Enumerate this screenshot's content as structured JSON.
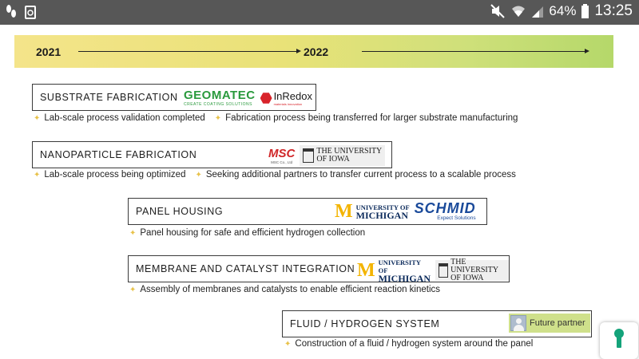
{
  "status_bar": {
    "battery_percent": "64%",
    "time": "13:25",
    "icons": [
      "steps-icon",
      "recycle-icon",
      "mute-icon",
      "wifi-icon",
      "signal-icon",
      "battery-icon"
    ]
  },
  "timeline": {
    "year_start": "2021",
    "year_mid": "2022"
  },
  "rows": {
    "substrate": {
      "title": "SUBSTRATE FABRICATION",
      "logo1_main": "GEOMATEC",
      "logo1_sub": "CREATE COATING SOLUTIONS",
      "logo2_main": "InRedox",
      "logo2_sub": "materials innovation",
      "bullet1": "Lab-scale process validation completed",
      "bullet2": "Fabrication process being transferred for larger substrate manufacturing"
    },
    "nanoparticle": {
      "title": "NANOPARTICLE FABRICATION",
      "logo1_main": "MSC",
      "logo1_sub": "MSC Co., Ltd",
      "logo2_l1": "THE UNIVERSITY",
      "logo2_l2": "OF IOWA",
      "bullet1": "Lab-scale process being optimized",
      "bullet2": "Seeking additional partners to transfer current process to a scalable process"
    },
    "panel": {
      "title": "PANEL HOUSING",
      "logo1_m": "M",
      "logo1_l1": "UNIVERSITY OF",
      "logo1_l2": "MICHIGAN",
      "logo2_main": "SCHMID",
      "logo2_sub": "Expect Solutions",
      "bullet1": "Panel housing for safe and efficient hydrogen collection"
    },
    "membrane": {
      "title": "MEMBRANE AND CATALYST INTEGRATION",
      "logo1_m": "M",
      "logo1_l1": "UNIVERSITY OF",
      "logo1_l2": "MICHIGAN",
      "logo2_l1": "THE UNIVERSITY",
      "logo2_l2": "OF IOWA",
      "bullet1": "Assembly of membranes and catalysts to enable efficient reaction kinetics"
    },
    "fluid": {
      "title": "FLUID / HYDROGEN SYSTEM",
      "partner": "Future partner",
      "bullet1": "Construction of a fluid / hydrogen system around the panel"
    }
  },
  "colors": {
    "banner_start": "#f4e48a",
    "banner_end": "#b5d86a",
    "bullet_star": "#e8c24a",
    "accessibility_key": "#14a37a"
  }
}
